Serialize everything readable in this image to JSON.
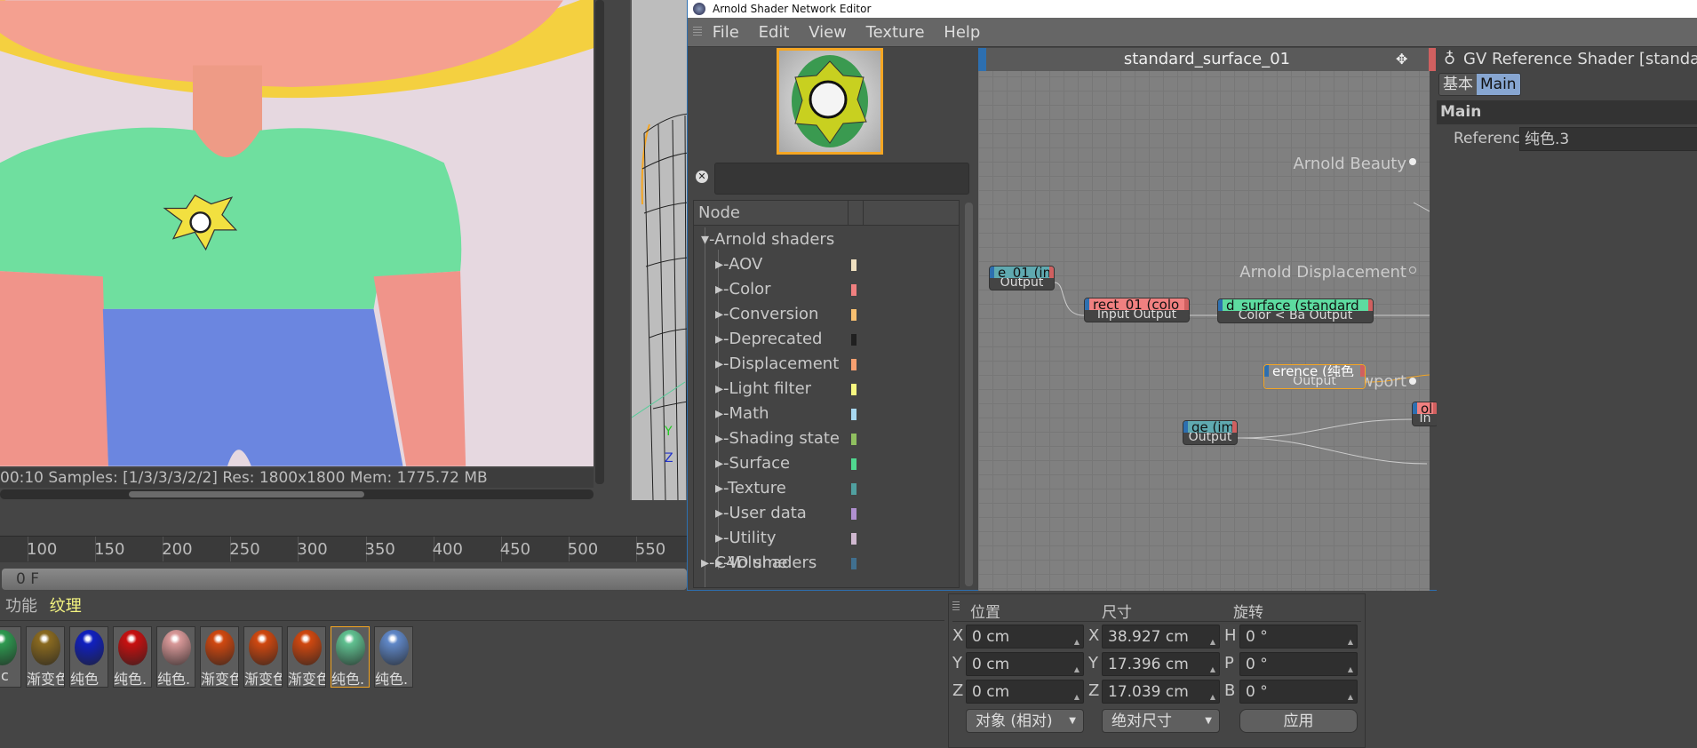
{
  "render_view": {
    "status": "00:10  Samples: [1/3/3/3/2/2]  Res: 1800x1800  Mem: 1775.72 MB"
  },
  "viewport_axes": {
    "y": "Y",
    "z": "Z"
  },
  "timeline": {
    "ticks": [
      "100",
      "150",
      "200",
      "250",
      "300",
      "350",
      "400",
      "450",
      "500",
      "550"
    ],
    "frame": "0 F"
  },
  "arnold_editor": {
    "title": "Arnold Shader Network Editor",
    "menu": [
      "File",
      "Edit",
      "View",
      "Texture",
      "Help"
    ],
    "search": {
      "value": "",
      "placeholder": ""
    },
    "tree": {
      "header": "Node",
      "root": "Arnold shaders",
      "items": [
        {
          "label": "AOV",
          "color": "#efe0c0"
        },
        {
          "label": "Color",
          "color": "#f08080"
        },
        {
          "label": "Conversion",
          "color": "#f8c070"
        },
        {
          "label": "Deprecated",
          "color": "#202020"
        },
        {
          "label": "Displacement",
          "color": "#f8a070"
        },
        {
          "label": "Light filter",
          "color": "#f8f880"
        },
        {
          "label": "Math",
          "color": "#a8d8f0"
        },
        {
          "label": "Shading state",
          "color": "#90c060"
        },
        {
          "label": "Surface",
          "color": "#50d890"
        },
        {
          "label": "Texture",
          "color": "#50a0a0"
        },
        {
          "label": "User data",
          "color": "#b090d0"
        },
        {
          "label": "Utility",
          "color": "#d0b8d0"
        },
        {
          "label": "Volume",
          "color": "#407090"
        }
      ],
      "next_root": {
        "label": "C4D shaders",
        "color": "#60a080"
      }
    },
    "graph": {
      "title": "standard_surface_01",
      "nodes": [
        {
          "header": "e_01 (im",
          "ports": "Output",
          "color": "#5fa9b0"
        },
        {
          "header": "rect_01 (colo",
          "ports": "Input Output",
          "color": "#f08080"
        },
        {
          "header": "d_surface (standard",
          "ports": "Color < Ba Output",
          "color": "#5ddba0"
        },
        {
          "header": "erence (纯色",
          "ports": "Output",
          "color": "#8a8a8a"
        },
        {
          "header": "ge (im",
          "ports": "Output",
          "color": "#5fa9b0"
        },
        {
          "header": "ol",
          "ports": "In",
          "color": "#f08080"
        }
      ],
      "outputs": [
        "Arnold Beauty",
        "Arnold Displacement",
        "Arnold Viewport"
      ]
    },
    "attributes": {
      "title": "GV Reference Shader [standard",
      "tabs": [
        "基本",
        "Main"
      ],
      "active_tab": "Main",
      "section": "Main",
      "reference_label": "Reference",
      "reference_value": "纯色.3"
    }
  },
  "materials": {
    "tabs": [
      "功能",
      "纹理"
    ],
    "active_tab": "纹理",
    "items": [
      {
        "label": "anc",
        "color": "#2e9a50"
      },
      {
        "label": "渐变色",
        "color": "#8a6a20"
      },
      {
        "label": "纯色",
        "color": "#1020c0"
      },
      {
        "label": "纯色.",
        "color": "#c81010"
      },
      {
        "label": "纯色.",
        "color": "#d89898"
      },
      {
        "label": "渐变色",
        "color": "#d04810"
      },
      {
        "label": "渐变色",
        "color": "#d04810"
      },
      {
        "label": "渐变色",
        "color": "#d04810"
      },
      {
        "label": "纯色.",
        "color": "#60c090",
        "selected": true
      },
      {
        "label": "纯色.",
        "color": "#6088c8"
      }
    ]
  },
  "coordinates": {
    "headers": [
      "位置",
      "尺寸",
      "旋转"
    ],
    "rows": [
      {
        "a": "X",
        "pos": "0 cm",
        "b": "X",
        "size": "38.927 cm",
        "c": "H",
        "rot": "0 °"
      },
      {
        "a": "Y",
        "pos": "0 cm",
        "b": "Y",
        "size": "17.396 cm",
        "c": "P",
        "rot": "0 °"
      },
      {
        "a": "Z",
        "pos": "0 cm",
        "b": "Z",
        "size": "17.039 cm",
        "c": "B",
        "rot": "0 °"
      }
    ],
    "mode_dropdown": "对象 (相对)",
    "size_dropdown": "绝对尺寸",
    "apply": "应用"
  }
}
